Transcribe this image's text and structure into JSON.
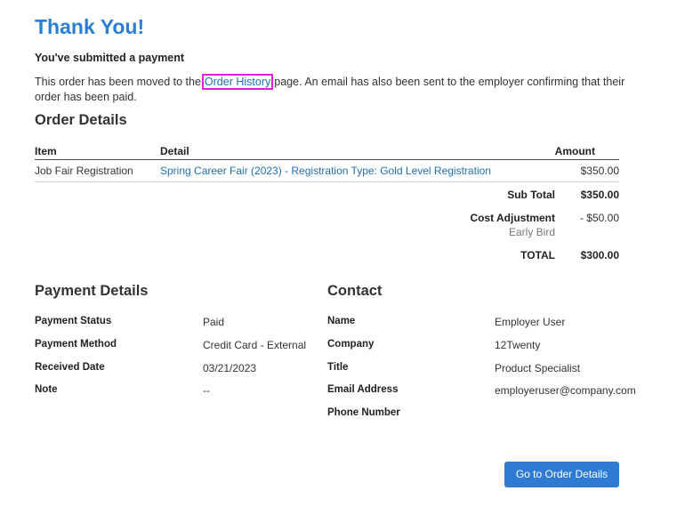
{
  "header": {
    "title": "Thank You!",
    "subtitle": "You've submitted a payment",
    "message_before": "This order has been moved to the",
    "message_link": "Order History",
    "message_after": "page. An email has also been sent to the employer confirming that their order has been paid."
  },
  "order_details": {
    "title": "Order Details",
    "columns": [
      "Item",
      "Detail",
      "Amount"
    ],
    "rows": [
      {
        "item": "Job Fair Registration",
        "detail": "Spring Career Fair (2023) - Registration Type: Gold Level Registration",
        "amount": "$350.00"
      }
    ],
    "subtotal_label": "Sub Total",
    "subtotal_value": "$350.00",
    "adjustment_label": "Cost Adjustment",
    "adjustment_value": "- $50.00",
    "adjustment_note": "Early Bird",
    "total_label": "TOTAL",
    "total_value": "$300.00"
  },
  "payment_details": {
    "title": "Payment Details",
    "fields": [
      {
        "label": "Payment Status",
        "value": "Paid"
      },
      {
        "label": "Payment Method",
        "value": "Credit Card - External"
      },
      {
        "label": "Received Date",
        "value": "03/21/2023"
      },
      {
        "label": "Note",
        "value": "--"
      }
    ]
  },
  "contact": {
    "title": "Contact",
    "fields": [
      {
        "label": "Name",
        "value": "Employer User"
      },
      {
        "label": "Company",
        "value": "12Twenty"
      },
      {
        "label": "Title",
        "value": "Product Specialist"
      },
      {
        "label": "Email Address",
        "value": "employeruser@company.com"
      },
      {
        "label": "Phone Number",
        "value": ""
      }
    ]
  },
  "actions": {
    "go_to_order_details": "Go to Order Details"
  },
  "colors": {
    "title_blue": "#2a7fd4",
    "link_blue": "#1f6fb2",
    "button_blue": "#2f7ad2",
    "highlight_magenta": "#e020d8"
  }
}
